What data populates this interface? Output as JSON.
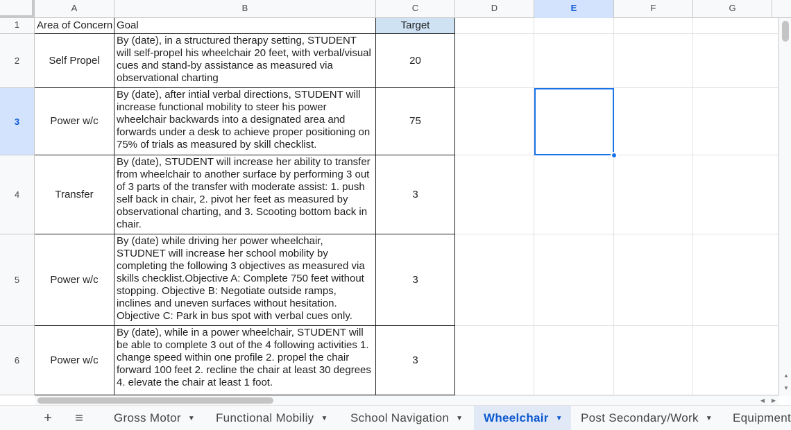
{
  "columns": [
    "A",
    "B",
    "C",
    "D",
    "E",
    "F",
    "G"
  ],
  "rows": [
    "1",
    "2",
    "3",
    "4",
    "5",
    "6"
  ],
  "header": {
    "area": "Area of Concern",
    "goal": "Goal",
    "target": "Target"
  },
  "data_rows": [
    {
      "area": "Self Propel",
      "goal": "By (date), in a structured therapy setting, STUDENT will self-propel his wheelchair 20 feet, with verbal/visual cues and stand-by assistance as measured via observational charting",
      "target": "20"
    },
    {
      "area": "Power w/c",
      "goal": "By (date), after intial verbal directions, STUDENT will increase functional mobility to steer his power wheelchair backwards into a designated area and forwards under a desk to achieve proper positioning on 75% of trials as measured by skill checklist.",
      "target": "75"
    },
    {
      "area": "Transfer",
      "goal": "By (date), STUDENT will increase her ability to transfer from wheelchair to another surface by performing 3 out of 3 parts of the transfer with moderate assist: 1. push self back in chair, 2. pivot her feet as measured by observational charting, and 3. Scooting bottom back in chair.",
      "target": "3"
    },
    {
      "area": "Power w/c",
      "goal": "By (date) while driving her power wheelchair, STUDNET will increase her school mobility by completing the following 3 objectives as measured via skills checklist.Objective A: Complete 750 feet without stopping. Objective B: Negotiate outside ramps, inclines and uneven surfaces without hesitation. Objective C: Park in bus spot with verbal cues only.",
      "target": "3"
    },
    {
      "area": "Power w/c",
      "goal": "By (date), while in a power wheelchair, STUDENT will be able to complete 3 out of the 4 following activities 1. change speed within one profile 2. propel the chair forward 100 feet 2. recline the chair at least 30 degrees 4. elevate the chair at least 1 foot.",
      "target": "3"
    }
  ],
  "selection": {
    "column": "E",
    "row": "3"
  },
  "tabs": {
    "add_icon": "plus-icon",
    "menu_icon": "hamburger-menu-icon",
    "sheets": [
      {
        "label": "Gross Motor",
        "active": false
      },
      {
        "label": "Functional Mobiliy",
        "active": false
      },
      {
        "label": "School Navigation",
        "active": false
      },
      {
        "label": "Wheelchair",
        "active": true
      },
      {
        "label": "Post Secondary/Work",
        "active": false
      },
      {
        "label": "Equipment",
        "active": false
      }
    ]
  },
  "colors": {
    "accent": "#1a73e8",
    "header_fill": "#cfe2f3",
    "selected_header": "#d3e3fd"
  }
}
